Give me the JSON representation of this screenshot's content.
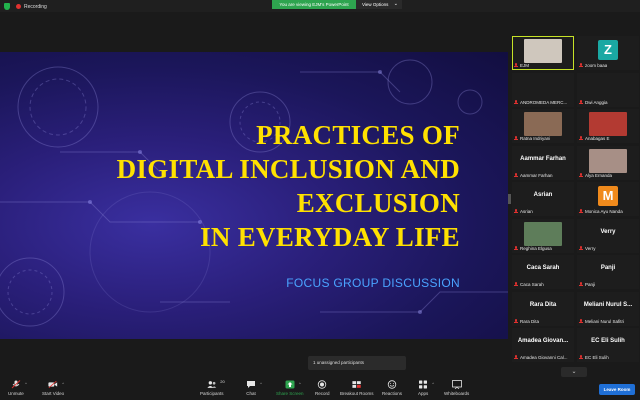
{
  "topbar": {
    "recording_label": "Recording",
    "banner_text": "You are viewing EJM's PowerPoint",
    "view_options_label": "View Options"
  },
  "slide": {
    "title_lines": [
      "PRACTICES OF",
      "DIGITAL INCLUSION AND",
      "EXCLUSION",
      "IN EVERYDAY LIFE"
    ],
    "subtitle": "FOCUS GROUP DISCUSSION"
  },
  "participants": [
    {
      "name": "EJM",
      "kind": "photo",
      "color": "#cfc7bd",
      "active": true
    },
    {
      "name": "zoom baaa",
      "kind": "letter",
      "letter": "Z",
      "color": "#1aa8a3"
    },
    {
      "name": "ANDROMEDA MERC...",
      "kind": "blank"
    },
    {
      "name": "Dwi Anggia",
      "kind": "blank"
    },
    {
      "name": "Ratna Indriyani",
      "kind": "photo",
      "color": "#8a6a55"
    },
    {
      "name": "Anabagas E",
      "kind": "photo",
      "color": "#b33a32"
    },
    {
      "name": "Aammar Farhan",
      "kind": "big",
      "big": "Aammar Farhan"
    },
    {
      "name": "Alya Ernanda",
      "kind": "photo",
      "color": "#a78f86"
    },
    {
      "name": "Asrian",
      "kind": "big",
      "big": "Asrian"
    },
    {
      "name": "Monica Ayu Nanda",
      "kind": "letter",
      "letter": "M",
      "color": "#f08a1c"
    },
    {
      "name": "Reghina Elgusa",
      "kind": "photo",
      "color": "#5e7d5a"
    },
    {
      "name": "Verry",
      "kind": "big",
      "big": "Verry"
    },
    {
      "name": "Caca Sarah",
      "kind": "big",
      "big": "Caca Sarah"
    },
    {
      "name": "Panji",
      "kind": "big",
      "big": "Panji"
    },
    {
      "name": "Rara Dita",
      "kind": "big",
      "big": "Rara Dita"
    },
    {
      "name": "Meliani Nurul Safitri",
      "kind": "big",
      "big": "Meliani Nurul S..."
    },
    {
      "name": "Amadea Giovanni Cal...",
      "kind": "big",
      "big": "Amadea Giovan..."
    },
    {
      "name": "EC Eli Sulih",
      "kind": "big",
      "big": "EC Eli Sulih"
    }
  ],
  "unassigned_label": "1 unassigned participants",
  "toolbar": {
    "unmute": "Unmute",
    "start_video": "Start Video",
    "participants": "Participants",
    "participants_count": "20",
    "chat": "Chat",
    "share_screen": "Share Screen",
    "record": "Record",
    "breakout_rooms": "Breakout Rooms",
    "reactions": "Reactions",
    "apps": "Apps",
    "whiteboards": "Whiteboards",
    "leave_room": "Leave Room"
  },
  "colors": {
    "accent_green": "#2ea44f",
    "title_yellow": "#ffe100",
    "subtitle_blue": "#4aa3ff",
    "leave_blue": "#1f6fd6",
    "mic_red": "#e0312f"
  }
}
